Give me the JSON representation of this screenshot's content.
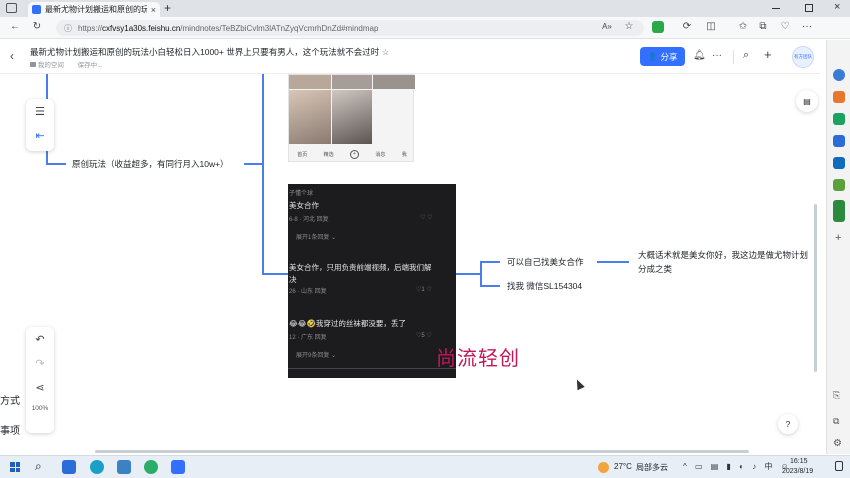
{
  "browser": {
    "tab_title": "最新尤物计划搬运和原创的玩法",
    "tab_close": "×",
    "new_tab": "+",
    "url_prefix": "https://",
    "url_host": "cxfvsy1a30s.feishu.cn",
    "url_path": "/mindnotes/TeBZbiCvlm3lATnZyqVcmrhDnZd#mindmap"
  },
  "doc": {
    "title": "最新尤物计划搬运和原创的玩法小白轻松日入1000+ 世界上只要有男人，这个玩法就不会过时",
    "breadcrumb_space": "我的空间",
    "save_status": "保存中...",
    "share_label": "分享",
    "more": "···",
    "workspace_label": "有方团队"
  },
  "mindmap": {
    "node_original": "原创玩法（收益超多，有同行月入10w+）",
    "node_find_self": "可以自己找美女合作",
    "node_contact": "找我 微信SL154304",
    "node_desc_line1": "大概话术就是美女你好，我这边是做尤物计划",
    "node_desc_line2": "分成之类",
    "watermark": "尚流轻创",
    "left_label_1": "方式",
    "left_label_2": "事项",
    "left_partial": "SL154304",
    "zoom": "100%"
  },
  "thumb_nav": [
    "首页",
    "精选",
    "+",
    "消息",
    "我"
  ],
  "comments": [
    {
      "text": "子懂个球",
      "meta": true
    },
    {
      "text": "美女合作"
    },
    {
      "text": "6-8 · 河北   回复",
      "meta": true
    },
    {
      "text": "展开1条回复 ⌄",
      "meta": true
    },
    {
      "text": "美女合作，只用负责前端视频，后端我们解"
    },
    {
      "text": "决"
    },
    {
      "text": "26 · 山东   回复",
      "meta": true
    },
    {
      "text": "😂😂🤣我穿过的丝袜都没要，丢了"
    },
    {
      "text": "12 · 广东   回复",
      "meta": true
    },
    {
      "text": "展开9条回复 ⌄",
      "meta": true
    }
  ],
  "comment_likes": [
    "",
    "1",
    "5"
  ],
  "taskbar": {
    "weather_temp": "27°C",
    "weather_desc": "局部多云",
    "time": "16:15",
    "date": "2023/8/19"
  },
  "colors": {
    "accent": "#3370ff",
    "branch_line": "#4a7ef0",
    "watermark": "#c2185b",
    "dark_image_bg": "#1c1c1e"
  }
}
